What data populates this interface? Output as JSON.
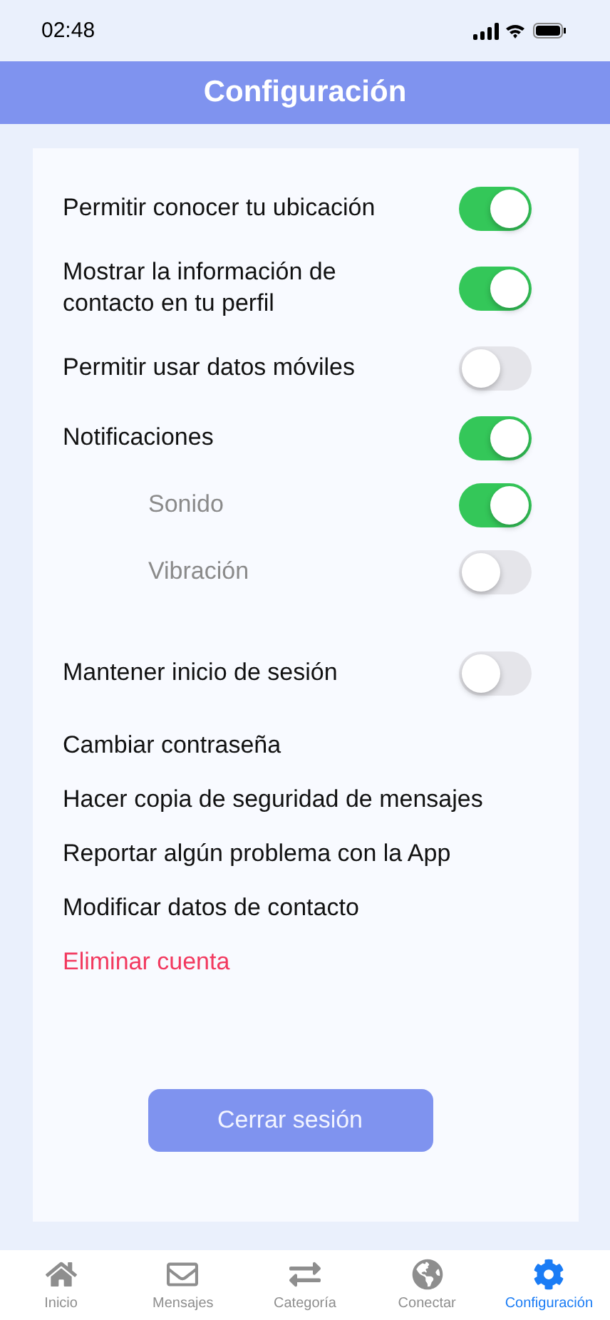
{
  "status_bar": {
    "time": "02:48"
  },
  "header": {
    "title": "Configuración"
  },
  "toggles": [
    {
      "label": "Permitir conocer tu ubicación",
      "on": true
    },
    {
      "label": "Mostrar la información de contacto en tu perfil",
      "on": true
    },
    {
      "label": "Permitir usar datos móviles",
      "on": false
    },
    {
      "label": "Notificaciones",
      "on": true,
      "children": [
        {
          "label": "Sonido",
          "on": true
        },
        {
          "label": "Vibración",
          "on": false
        }
      ]
    }
  ],
  "session_toggle": {
    "label": "Mantener inicio de sesión",
    "on": false
  },
  "actions": [
    {
      "label": "Cambiar contraseña",
      "kind": "normal"
    },
    {
      "label": "Hacer copia de seguridad de mensajes",
      "kind": "normal"
    },
    {
      "label": "Reportar algún problema con la App",
      "kind": "normal"
    },
    {
      "label": "Modificar datos de contacto",
      "kind": "normal"
    },
    {
      "label": "Eliminar cuenta",
      "kind": "danger"
    }
  ],
  "logout_button": "Cerrar sesión",
  "tab_bar": [
    {
      "label": "Inicio",
      "kind": "home",
      "selected": false
    },
    {
      "label": "Mensajes",
      "kind": "mail",
      "selected": false
    },
    {
      "label": "Categoría",
      "kind": "swap",
      "selected": false
    },
    {
      "label": "Conectar",
      "kind": "globe",
      "selected": false
    },
    {
      "label": "Configuración",
      "kind": "gear",
      "selected": true
    }
  ]
}
